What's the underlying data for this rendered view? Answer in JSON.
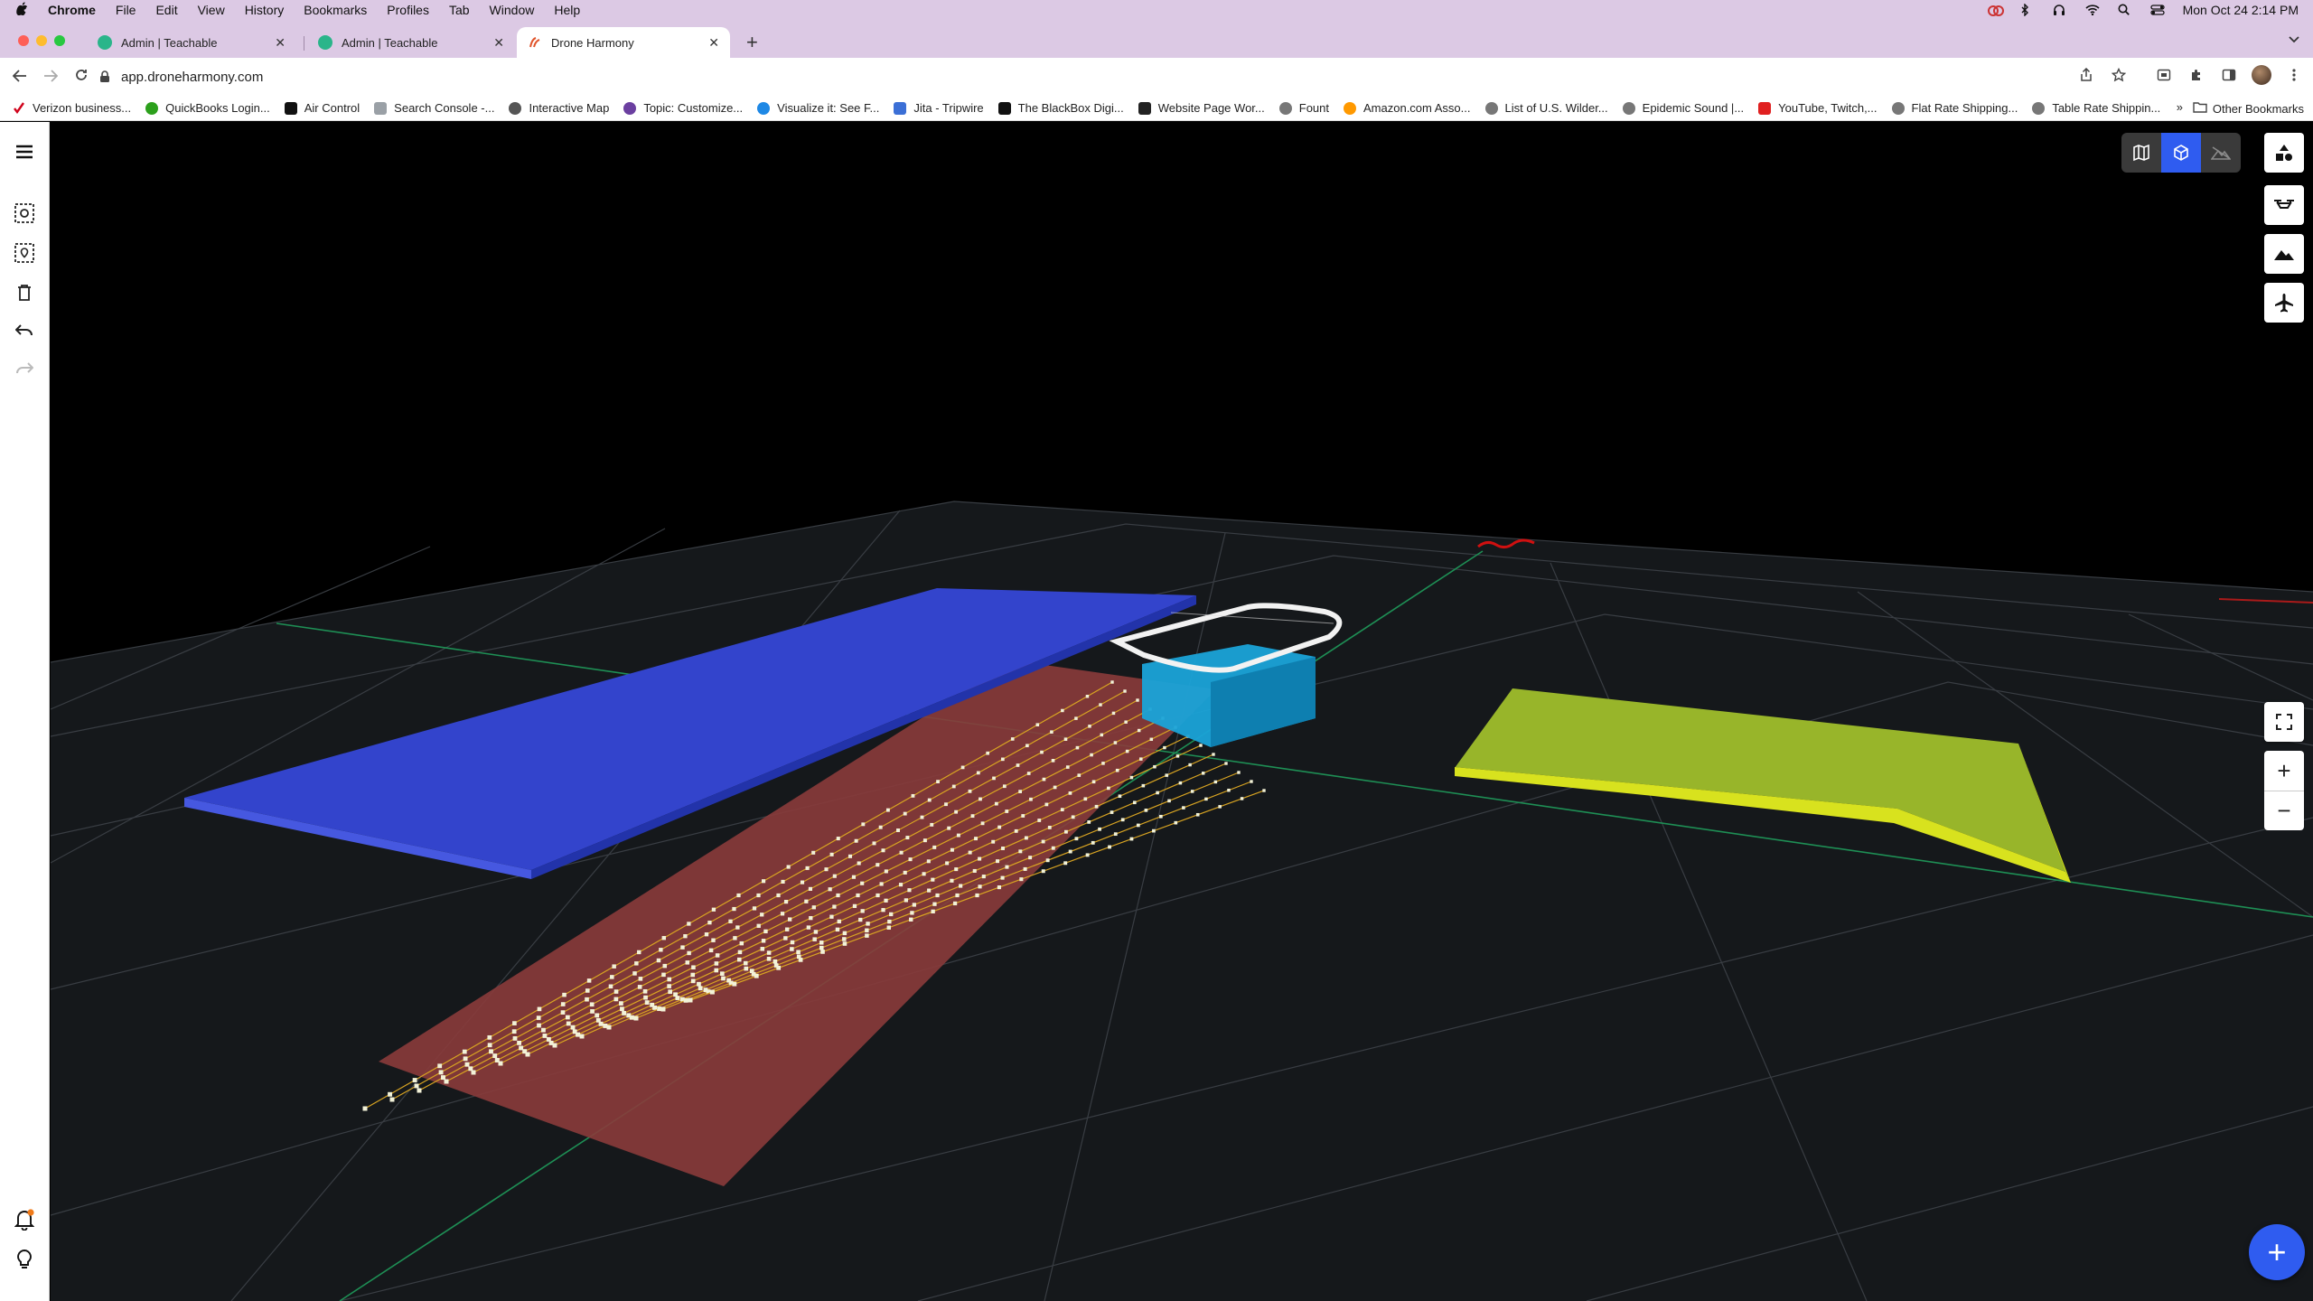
{
  "menubar": {
    "apple": "",
    "app_name": "Chrome",
    "menus": [
      "File",
      "Edit",
      "View",
      "History",
      "Bookmarks",
      "Profiles",
      "Tab",
      "Window",
      "Help"
    ],
    "clock": "Mon Oct 24  2:14 PM"
  },
  "tabs": [
    {
      "title": "Admin | Teachable",
      "active": false
    },
    {
      "title": "Admin | Teachable",
      "active": false
    },
    {
      "title": "Drone Harmony",
      "active": true
    }
  ],
  "toolbar": {
    "url": "app.droneharmony.com"
  },
  "bookmarks": {
    "items": [
      "Verizon business...",
      "QuickBooks Login...",
      "Air Control",
      "Search Console -...",
      "Interactive Map",
      "Topic: Customize...",
      "Visualize it: See F...",
      "Jita - Tripwire",
      "The BlackBox Digi...",
      "Website Page Wor...",
      "Fount",
      "Amazon.com Asso...",
      "List of U.S. Wilder...",
      "Epidemic Sound |...",
      "YouTube, Twitch,...",
      "Flat Rate Shipping...",
      "Table Rate Shippin..."
    ],
    "more": "»",
    "other": "Other Bookmarks"
  },
  "colors": {
    "accent": "#2f5cf0",
    "blue_area": "#3344cc",
    "red_area": "#8a3b3b",
    "yellow_area": "#b5cc1e",
    "cyan_building": "#1aa3d8",
    "notification_dot": "#f07b1a"
  },
  "viewport": {
    "view_modes": [
      "map-view-icon",
      "3d-view-icon",
      "terrain-view-icon"
    ],
    "active_view": "3d-view-icon",
    "side_tools": [
      "layers-icon",
      "drone-icon",
      "terrain-icon",
      "airplane-icon"
    ],
    "zoom_in": "+",
    "zoom_out": "−",
    "fab": "+"
  }
}
